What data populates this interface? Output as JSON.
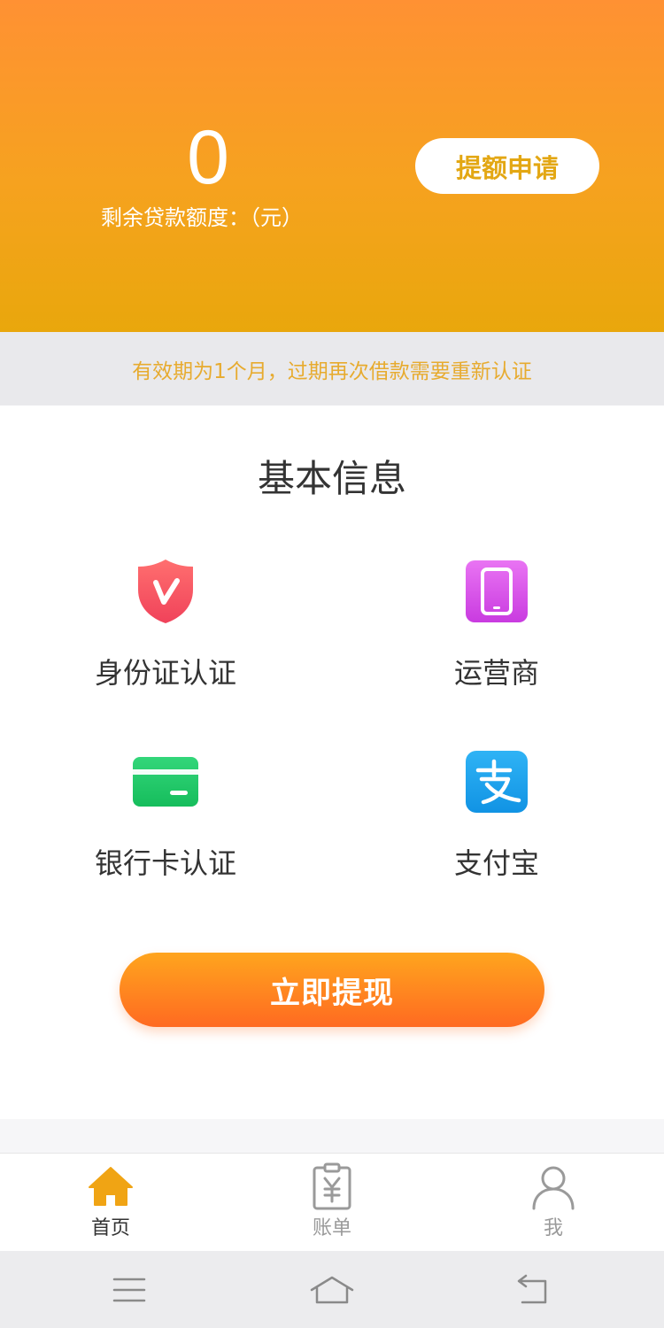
{
  "header": {
    "quota_value": "0",
    "quota_label": "剩余贷款额度：（元）",
    "raise_button": "提额申请"
  },
  "notice": "有效期为1个月，过期再次借款需要重新认证",
  "basic_info": {
    "title": "基本信息",
    "items": [
      {
        "label": "身份证认证",
        "icon": "shield-check-icon",
        "color": "#f4505e"
      },
      {
        "label": "运营商",
        "icon": "phone-icon",
        "color": "#d44ee8"
      },
      {
        "label": "银行卡认证",
        "icon": "bank-card-icon",
        "color": "#22c768"
      },
      {
        "label": "支付宝",
        "icon": "alipay-icon",
        "color": "#1aa2f0"
      }
    ]
  },
  "withdraw_button": "立即提现",
  "tabbar": {
    "items": [
      {
        "label": "首页",
        "icon": "home-icon",
        "active": true
      },
      {
        "label": "账单",
        "icon": "bill-icon",
        "active": false
      },
      {
        "label": "我",
        "icon": "user-icon",
        "active": false
      }
    ]
  },
  "colors": {
    "accent": "#f29a1e",
    "button_gradient_start": "#ffa51e",
    "button_gradient_end": "#ff6a21",
    "notice_text": "#e7ab2f"
  }
}
